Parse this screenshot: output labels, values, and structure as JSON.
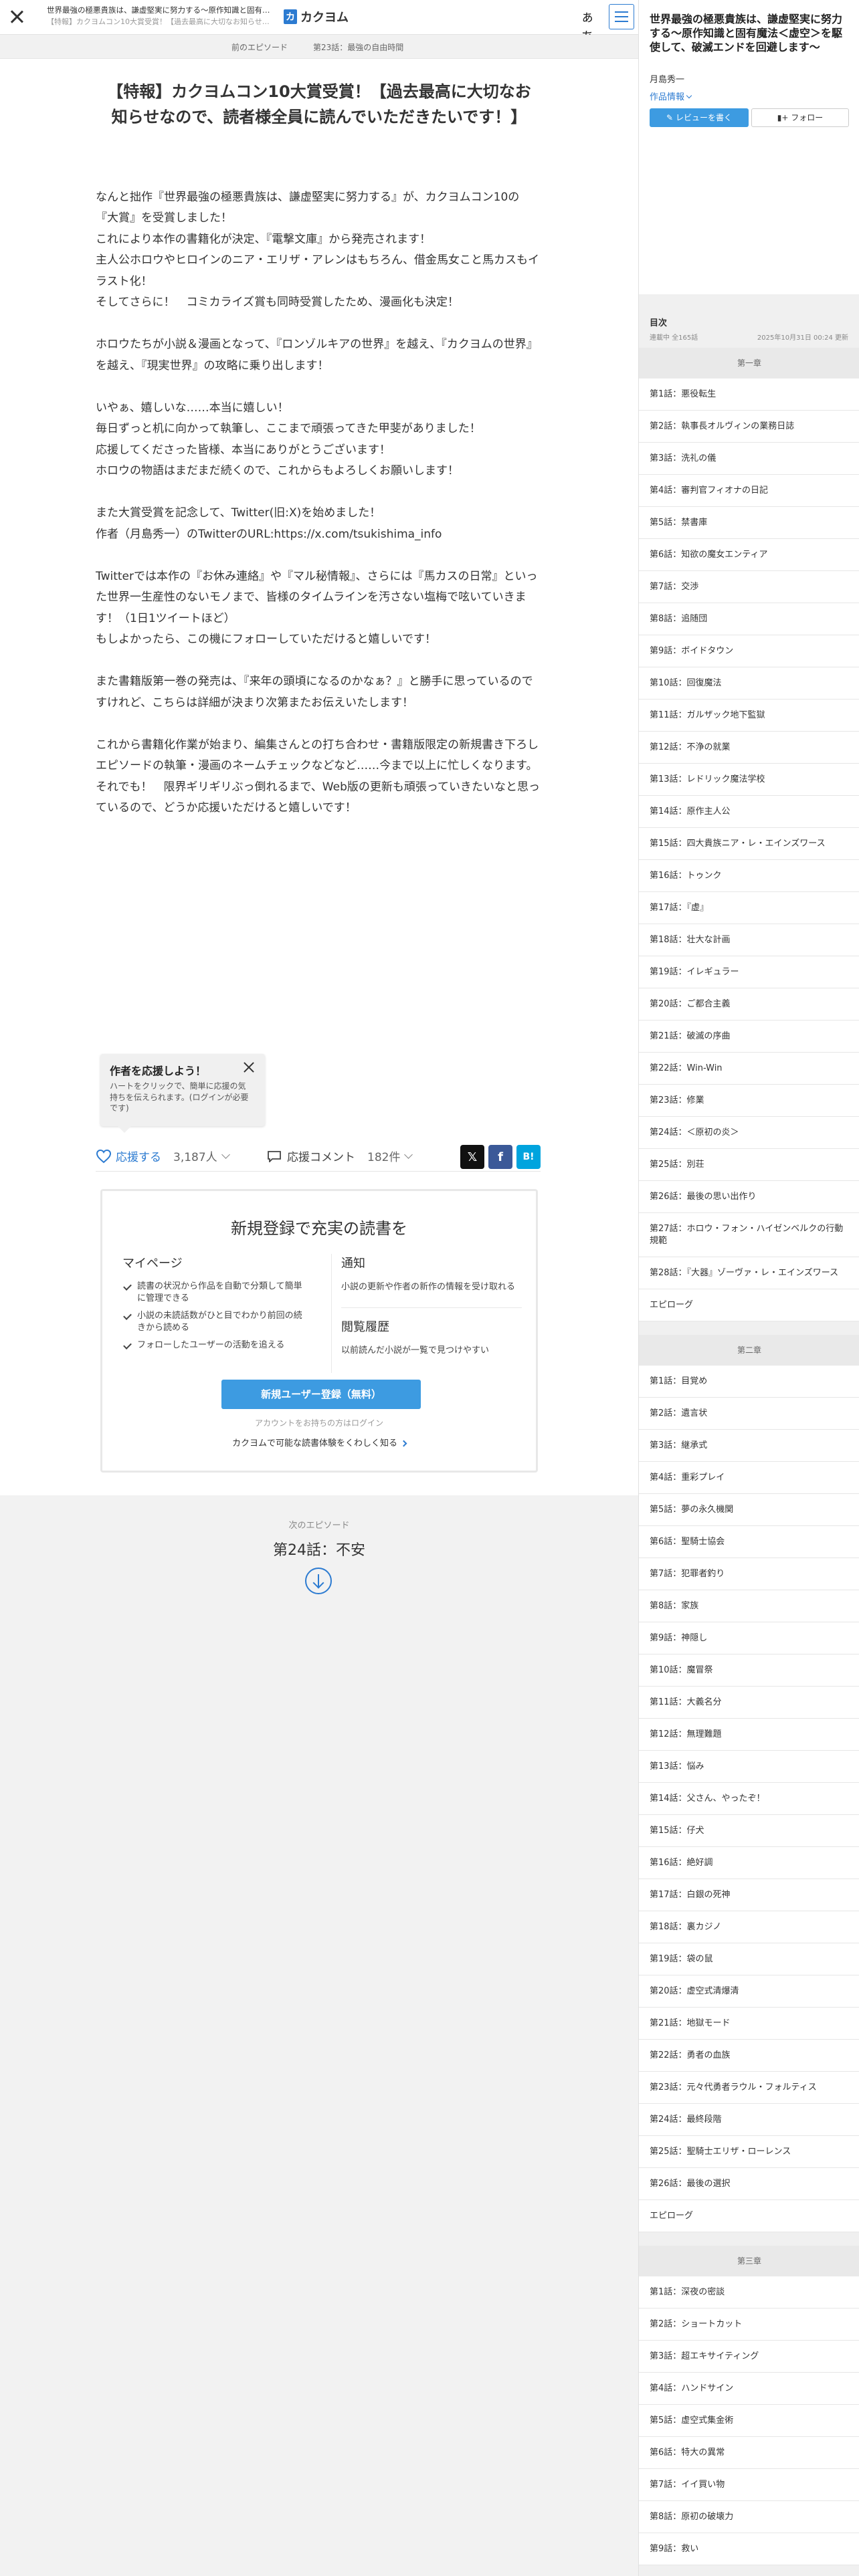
{
  "topbar": {
    "title": "世界最強の極悪貴族は、謙虚堅実に努力する〜原作知識と固有魔法＜虚空＞を駆使して、破滅エンドを回避します〜",
    "subtitle": "【特報】カクヨムコン10大賞受賞！【過去最高に大切なお知らせなので、読者様全員に読んでいただきたいです！】",
    "logo_mark": "カ",
    "logo_text": "カクヨム",
    "font_button": "ぁあ"
  },
  "episode_nav": {
    "prev": "前のエピソード",
    "current": "第23話：最強の自由時間"
  },
  "episode": {
    "title": "【特報】カクヨムコン10大賞受賞！【過去最高に大切なお知らせなので、読者様全員に読んでいただきたいです！】",
    "paragraphs": [
      "",
      "なんと拙作『世界最強の極悪貴族は、謙虚堅実に努力する』が、カクヨムコン10の『大賞』を受賞しました！",
      "これにより本作の書籍化が決定、『電撃文庫』から発売されます！",
      "主人公ホロウやヒロインのニア・エリザ・アレンはもちろん、借金馬女こと馬カスもイラスト化！",
      "そしてさらに！　コミカライズ賞も同時受賞したため、漫画化も決定！",
      "",
      "ホロウたちが小説＆漫画となって、『ロンゾルキアの世界』を越え、『カクヨムの世界』を越え、『現実世界』の攻略に乗り出します！",
      "",
      "いやぁ、嬉しいな……本当に嬉しい！",
      "毎日ずっと机に向かって執筆し、ここまで頑張ってきた甲斐がありました！",
      "応援してくださった皆様、本当にありがとうございます！",
      "ホロウの物語はまだまだ続くので、これからもよろしくお願いします！",
      "",
      "また大賞受賞を記念して、Twitter(旧:X)を始めました！",
      "作者（月島秀一）のTwitterのURL:https://x.com/tsukishima_info",
      "",
      "Twitterでは本作の『お休み連絡』や『マル秘情報』、さらには『馬カスの日常』といった世界一生産性のないモノまで、皆様のタイムラインを汚さない塩梅で呟いていきます！（1日1ツイートほど）",
      "もしよかったら、この機にフォローしていただけると嬉しいです！",
      "",
      "また書籍版第一巻の発売は、『来年の頭頃になるのかなぁ？』と勝手に思っているのですけれど、こちらは詳細が決まり次第またお伝えいたします！",
      "",
      "これから書籍化作業が始まり、編集さんとの打ち合わせ・書籍版限定の新規書き下ろしエピソードの執筆・漫画のネームチェックなどなど……今まで以上に忙しくなります。",
      "それでも！　限界ギリギリぶっ倒れるまで、Web版の更新も頑張っていきたいなと思っているので、どうか応援いただけると嬉しいです！"
    ]
  },
  "tooltip": {
    "title": "作者を応援しよう！",
    "text": "ハートをクリックで、簡単に応援の気持ちを伝えられます。(ログインが必要です)"
  },
  "actions": {
    "cheer_label": "応援する",
    "cheer_count": "3,187人",
    "comment_label": "応援コメント",
    "comment_count": "182件",
    "x_glyph": "𝕏",
    "fb_glyph": "f",
    "hatena_glyph": "B!"
  },
  "signup": {
    "heading": "新規登録で充実の読書を",
    "mypage_title": "マイページ",
    "mypage_items": [
      "読書の状況から作品を自動で分類して簡単に管理できる",
      "小説の未読話数がひと目でわかり前回の続きから読める",
      "フォローしたユーザーの活動を追える"
    ],
    "notify_title": "通知",
    "notify_desc": "小説の更新や作者の新作の情報を受け取れる",
    "history_title": "閲覧履歴",
    "history_desc": "以前読んだ小説が一覧で見つけやすい",
    "button": "新規ユーザー登録（無料）",
    "login_text": "アカウントをお持ちの方はログイン",
    "more_link": "カクヨムで可能な読書体験をくわしく知る"
  },
  "next": {
    "label": "次のエピソード",
    "title": "第24話：不安"
  },
  "sidebar": {
    "title": "世界最強の極悪貴族は、謙虚堅実に努力する〜原作知識と固有魔法＜虚空＞を駆使して、破滅エンドを回避します〜",
    "author": "月島秀一",
    "info_link": "作品情報",
    "review_button": "レビューを書く",
    "follow_button": "フォロー",
    "toc_heading": "目次",
    "status": "連載中 全165話",
    "updated": "2025年10月31日 00:24 更新",
    "chapters": [
      {
        "name": "第一章",
        "episodes": [
          "第1話：悪役転生",
          "第2話：執事長オルヴィンの業務日誌",
          "第3話：洗礼の儀",
          "第4話：審判官フィオナの日記",
          "第5話：禁書庫",
          "第6話：知欲の魔女エンティア",
          "第7話：交渉",
          "第8話：追随団",
          "第9話：ボイドタウン",
          "第10話：回復魔法",
          "第11話：ガルザック地下監獄",
          "第12話：不浄の就業",
          "第13話：レドリック魔法学校",
          "第14話：原作主人公",
          "第15話：四大貴族ニア・レ・エインズワース",
          "第16話：トゥンク",
          "第17話：『虚』",
          "第18話：壮大な計画",
          "第19話：イレギュラー",
          "第20話：ご都合主義",
          "第21話：破滅の序曲",
          "第22話：Win-Win",
          "第23話：修業",
          "第24話：＜原初の炎＞",
          "第25話：別荘",
          "第26話：最後の思い出作り",
          "第27話：ホロウ・フォン・ハイゼンベルクの行動規範",
          "第28話：『大器』ゾーヴァ・レ・エインズワース",
          "エピローグ"
        ]
      },
      {
        "name": "第二章",
        "episodes": [
          "第1話：目覚め",
          "第2話：遺言状",
          "第3話：継承式",
          "第4話：重彩プレイ",
          "第5話：夢の永久機関",
          "第6話：聖騎士協会",
          "第7話：犯罪者釣り",
          "第8話：家族",
          "第9話：神隠し",
          "第10話：魔冒祭",
          "第11話：大義名分",
          "第12話：無理難題",
          "第13話：悩み",
          "第14話：父さん、やったぞ！",
          "第15話：仔犬",
          "第16話：絶好調",
          "第17話：白銀の死神",
          "第18話：裏カジノ",
          "第19話：袋の鼠",
          "第20話：虚空式清爆清",
          "第21話：地獄モード",
          "第22話：勇者の血族",
          "第23話：元々代勇者ラウル・フォルティス",
          "第24話：最終段階",
          "第25話：聖騎士エリザ・ローレンス",
          "第26話：最後の選択",
          "エピローグ"
        ]
      },
      {
        "name": "第三章",
        "episodes": [
          "第1話：深夜の密談",
          "第2話：ショートカット",
          "第3話：超エキサイティング",
          "第4話：ハンドサイン",
          "第5話：虚空式集金術",
          "第6話：特大の異常",
          "第7話：イイ買い物",
          "第8話：原初の破壊力",
          "第9話：救い"
        ]
      }
    ]
  }
}
